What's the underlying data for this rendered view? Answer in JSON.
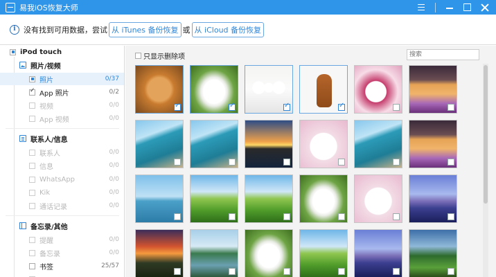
{
  "window": {
    "title": "易我iOS恢复大师"
  },
  "infobar": {
    "text": "没有找到可用数据，尝试",
    "itunes_button": "从 iTunes 备份恢复",
    "or_text": "或",
    "icloud_button": "从 iCloud 备份恢复"
  },
  "sidebar": {
    "device": "iPod touch",
    "sections": [
      {
        "title": "照片/视频",
        "items": [
          {
            "label": "照片",
            "count": "0/37"
          },
          {
            "label": "App 照片",
            "count": "0/2"
          },
          {
            "label": "视频",
            "count": "0/0"
          },
          {
            "label": "App 视频",
            "count": "0/0"
          }
        ]
      },
      {
        "title": "联系人/信息",
        "items": [
          {
            "label": "联系人",
            "count": "0/0"
          },
          {
            "label": "信息",
            "count": "0/0"
          },
          {
            "label": "WhatsApp",
            "count": "0/0"
          },
          {
            "label": "Kik",
            "count": "0/0"
          },
          {
            "label": "通话记录",
            "count": "0/0"
          }
        ]
      },
      {
        "title": "备忘录/其他",
        "items": [
          {
            "label": "提醒",
            "count": "0/0"
          },
          {
            "label": "备忘录",
            "count": "0/0"
          },
          {
            "label": "书签",
            "count": "25/57"
          },
          {
            "label": "",
            "count": ""
          }
        ]
      }
    ]
  },
  "main": {
    "show_deleted_label": "只显示删除项",
    "search_placeholder": "搜索",
    "photos": [
      {
        "icon": "pomeranian-photo",
        "checked": true
      },
      {
        "icon": "white-dog-grass-photo",
        "checked": true
      },
      {
        "icon": "three-white-dogs-photo",
        "checked": true
      },
      {
        "icon": "brown-puppy-photo",
        "checked": true
      },
      {
        "icon": "bunny-kitten-photo",
        "checked": false
      },
      {
        "icon": "kittens-flowers-photo",
        "checked": false
      },
      {
        "icon": "coast-photo",
        "checked": false
      },
      {
        "icon": "coast-photo",
        "checked": false
      },
      {
        "icon": "sunset-photo",
        "checked": false
      },
      {
        "icon": "white-bunny-photo",
        "checked": false
      },
      {
        "icon": "coast-photo",
        "checked": false
      },
      {
        "icon": "kittens-flowers-photo",
        "checked": false
      },
      {
        "icon": "coast-aerial-photo",
        "checked": false
      },
      {
        "icon": "green-hills-photo",
        "checked": false
      },
      {
        "icon": "green-hills-photo",
        "checked": false
      },
      {
        "icon": "white-dogs-grass-photo",
        "checked": false
      },
      {
        "icon": "white-bunny-photo",
        "checked": false
      },
      {
        "icon": "mountain-lake-photo",
        "checked": false
      },
      {
        "icon": "sunset-landscape-photo",
        "checked": false
      },
      {
        "icon": "river-village-photo",
        "checked": false
      },
      {
        "icon": "white-dogs-grass-photo",
        "checked": false
      },
      {
        "icon": "green-hills-photo",
        "checked": false
      },
      {
        "icon": "mountain-lake-photo",
        "checked": false
      },
      {
        "icon": "forest-hills-photo",
        "checked": false
      }
    ]
  }
}
